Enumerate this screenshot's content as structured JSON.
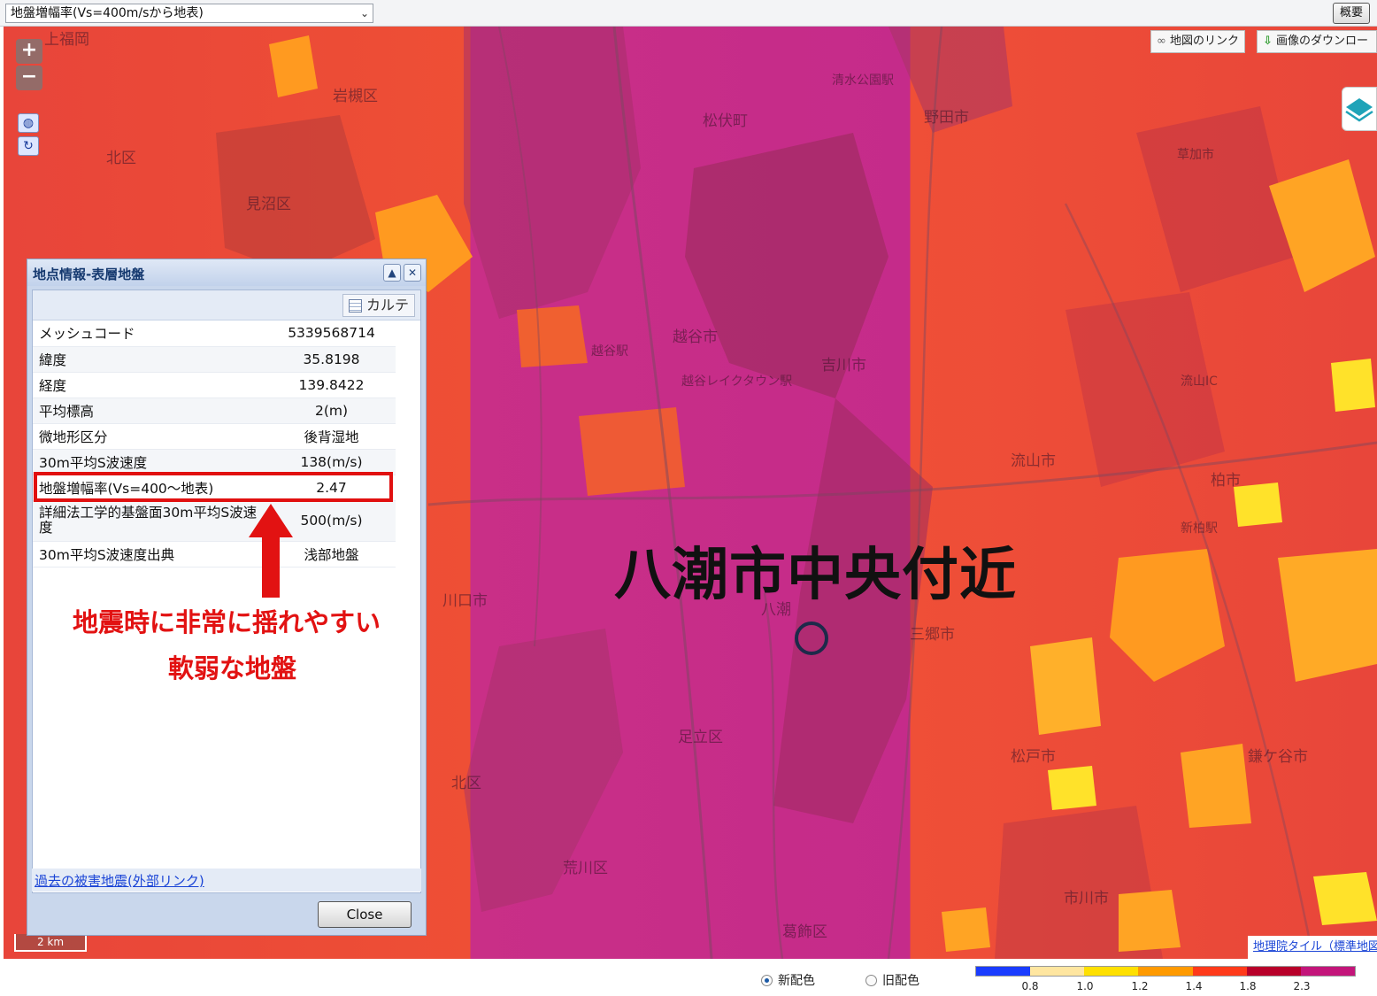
{
  "topbar": {
    "layer_select": "地盤増幅率(Vs=400m/sから地表)",
    "overview_button": "概要"
  },
  "map": {
    "zoom_in": "+",
    "zoom_out": "−",
    "link_button": "地図のリンク",
    "download_button": "画像のダウンロー",
    "scale_label": "2 km",
    "attribution": "地理院タイル（標準地図",
    "overlay_title": "八潮市中央付近",
    "places": [
      "上福岡",
      "岩槻区",
      "松伏町",
      "野田市",
      "北区",
      "見沼区",
      "越谷市",
      "吉川市",
      "流山市",
      "柏市",
      "川口市",
      "八潮",
      "三郷市",
      "足立区",
      "北区",
      "荒川区",
      "葛飾区",
      "松戸市",
      "市川市",
      "鎌ケ谷市",
      "清水公園駅",
      "越谷駅",
      "越谷レイクタウン駅",
      "流山IC",
      "新柏駅",
      "草加市"
    ]
  },
  "panel": {
    "title": "地点情報-表層地盤",
    "karte_button": "カルテ",
    "rows": [
      {
        "key": "メッシュコード",
        "value": "5339568714"
      },
      {
        "key": "緯度",
        "value": "35.8198"
      },
      {
        "key": "経度",
        "value": "139.8422"
      },
      {
        "key": "平均標高",
        "value": "2(m)"
      },
      {
        "key": "微地形区分",
        "value": "後背湿地"
      },
      {
        "key": "30m平均S波速度",
        "value": "138(m/s)"
      },
      {
        "key": "地盤増幅率(Vs=400～地表)",
        "value": "2.47"
      },
      {
        "key": "詳細法工学的基盤面30m平均S波速度",
        "value": "500(m/s)"
      },
      {
        "key": "30m平均S波速度出典",
        "value": "浅部地盤"
      }
    ],
    "past_link": "過去の被害地震(外部リンク)",
    "close_button": "Close"
  },
  "annotation": {
    "line1": "地震時に非常に揺れやすい",
    "line2": "軟弱な地盤"
  },
  "bottom": {
    "radio_new": "新配色",
    "radio_old": "旧配色",
    "legend_ticks": [
      "0.8",
      "1.0",
      "1.2",
      "1.4",
      "1.8",
      "2.3"
    ],
    "legend_colors": [
      "#1a3cff",
      "#ffe6a0",
      "#ffe000",
      "#ff9a00",
      "#ff3a1a",
      "#b8002a",
      "#c3157a"
    ]
  },
  "colors": {
    "annotation_red": "#e21212",
    "map_magenta": "#c52b8a",
    "map_red": "#ee4f35",
    "map_orange": "#ff9a20"
  }
}
